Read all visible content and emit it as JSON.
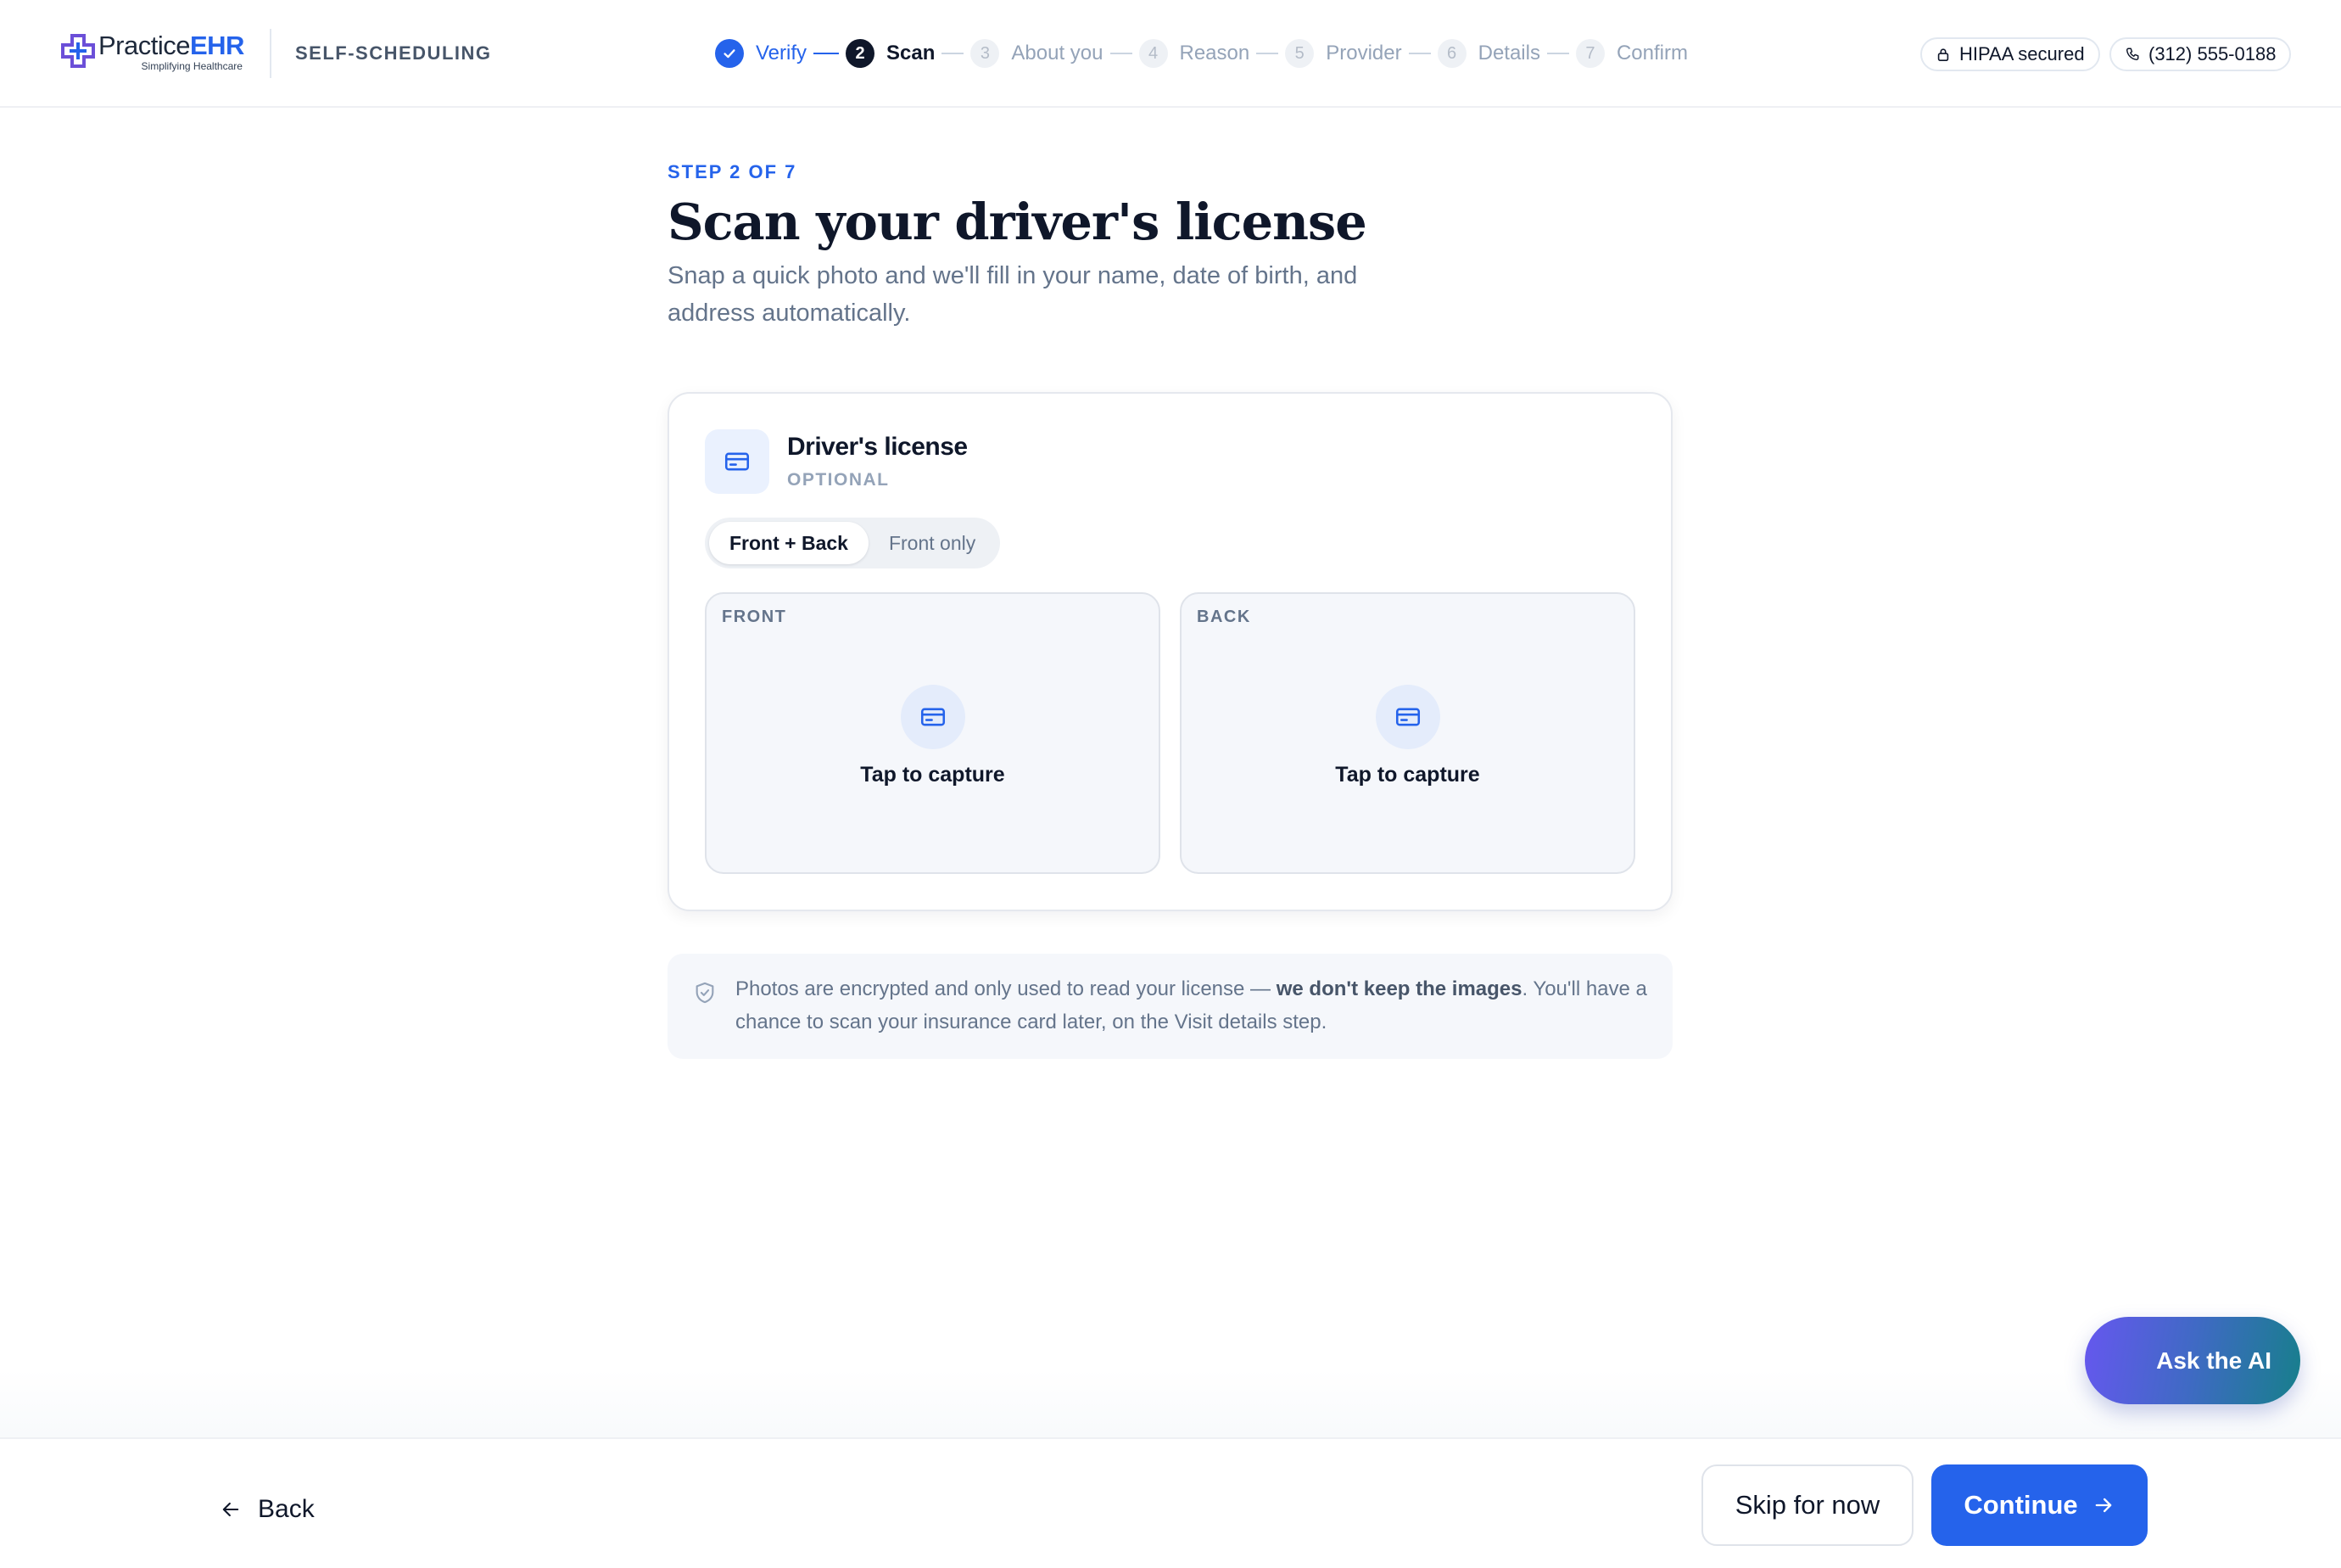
{
  "header": {
    "logo_word_1": "Practice",
    "logo_word_2": "EHR",
    "logo_tagline": "Simplifying Healthcare",
    "product_label": "SELF-SCHEDULING",
    "steps": [
      {
        "number": "1",
        "label": "Verify",
        "state": "done"
      },
      {
        "number": "2",
        "label": "Scan",
        "state": "current"
      },
      {
        "number": "3",
        "label": "About you",
        "state": "todo"
      },
      {
        "number": "4",
        "label": "Reason",
        "state": "todo"
      },
      {
        "number": "5",
        "label": "Provider",
        "state": "todo"
      },
      {
        "number": "6",
        "label": "Details",
        "state": "todo"
      },
      {
        "number": "7",
        "label": "Confirm",
        "state": "todo"
      }
    ],
    "hipaa_label": "HIPAA secured",
    "phone_label": "(312) 555-0188"
  },
  "main": {
    "eyebrow": "STEP 2 OF 7",
    "title": "Scan your driver's license",
    "subtitle": "Snap a quick photo and we'll fill in your name, date of birth, and address automatically.",
    "card": {
      "doc_title": "Driver's license",
      "doc_optional": "OPTIONAL",
      "mode_options": [
        "Front + Back",
        "Front only"
      ],
      "selected_mode": "Front + Back",
      "front_label": "FRONT",
      "back_label": "BACK",
      "capture_text": "Tap to capture"
    },
    "notice": {
      "text_before": "Photos are encrypted and only used to read your license — ",
      "text_bold": "we don't keep the images",
      "text_after": ". You'll have a chance to scan your insurance card later, on the Visit details step."
    }
  },
  "footer": {
    "back_label": "Back",
    "skip_label": "Skip for now",
    "continue_label": "Continue"
  },
  "ai_button_label": "Ask the AI",
  "colors": {
    "accent": "#2563eb",
    "text_primary": "#0f172a",
    "text_muted": "#64748b",
    "surface": "#f5f7fb"
  }
}
